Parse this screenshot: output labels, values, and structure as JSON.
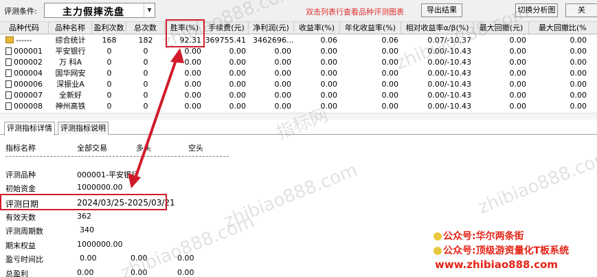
{
  "toolbar": {
    "cond_label": "评测条件:",
    "cond_value": "主力假摔洗盘",
    "hint": "双击列表行查看品种评测图表",
    "export_label": "导出结果",
    "switch_label": "切换分析图",
    "close_label": "关"
  },
  "columns": [
    "品种代码",
    "品种名称",
    "盈利次数",
    "总次数",
    "胜率(%)",
    "手续费(元)",
    "净利润(元)",
    "收益率(%)",
    "年化收益率(%)",
    "相对收益率α/β(%)",
    "最大回撤(元)",
    "最大回撤比(%"
  ],
  "rows": [
    {
      "code": "------",
      "name": "综合统计",
      "win": "168",
      "total": "182",
      "rate": "92.31",
      "fee": "369755.41",
      "profit": "3462696....",
      "ret": "0.06",
      "ann": "0.06",
      "rel": "0.07/-10.37",
      "dd": "0.00",
      "ddp": "0.00",
      "icon": "folder"
    },
    {
      "code": "000001",
      "name": "平安银行",
      "win": "0",
      "total": "0",
      "rate": "0.00",
      "fee": "0.00",
      "profit": "0.00",
      "ret": "0.00",
      "ann": "0.00",
      "rel": "0.00/-10.43",
      "dd": "0.00",
      "ddp": "0.00",
      "icon": "doc"
    },
    {
      "code": "000002",
      "name": "万 科A",
      "win": "0",
      "total": "0",
      "rate": "0.00",
      "fee": "0.00",
      "profit": "0.00",
      "ret": "0.00",
      "ann": "0.00",
      "rel": "0.00/-10.43",
      "dd": "0.00",
      "ddp": "0.00",
      "icon": "doc"
    },
    {
      "code": "000004",
      "name": "国华网安",
      "win": "0",
      "total": "0",
      "rate": "0.00",
      "fee": "0.00",
      "profit": "0.00",
      "ret": "0.00",
      "ann": "0.00",
      "rel": "0.00/-10.43",
      "dd": "0.00",
      "ddp": "0.00",
      "icon": "doc"
    },
    {
      "code": "000006",
      "name": "深振业A",
      "win": "0",
      "total": "0",
      "rate": "0.00",
      "fee": "0.00",
      "profit": "0.00",
      "ret": "0.00",
      "ann": "0.00",
      "rel": "0.00/-10.43",
      "dd": "0.00",
      "ddp": "0.00",
      "icon": "doc"
    },
    {
      "code": "000007",
      "name": "全新好",
      "win": "0",
      "total": "0",
      "rate": "0.00",
      "fee": "0.00",
      "profit": "0.00",
      "ret": "0.00",
      "ann": "0.00",
      "rel": "0.00/-10.43",
      "dd": "0.00",
      "ddp": "0.00",
      "icon": "doc"
    },
    {
      "code": "000008",
      "name": "神州高铁",
      "win": "0",
      "total": "0",
      "rate": "0.00",
      "fee": "0.00",
      "profit": "0.00",
      "ret": "0.00",
      "ann": "0.00",
      "rel": "0.00/-10.43",
      "dd": "0.00",
      "ddp": "0.00",
      "icon": "doc"
    }
  ],
  "tabs": [
    "评测指标详情",
    "评测指标说明"
  ],
  "detail": {
    "header": {
      "name": "指标名称",
      "all": "全部交易",
      "long": "多头",
      "short": "空头"
    },
    "stock": {
      "label": "评测品种",
      "value": "000001-平安银行"
    },
    "capital": {
      "label": "初始资金",
      "value": "1000000.00"
    },
    "date": {
      "label": "评测日期",
      "value": "2024/03/25-2025/03/21"
    },
    "valid_days": {
      "label": "有效天数",
      "value": "362"
    },
    "cycles": {
      "label": "评测周期数",
      "value": "340"
    },
    "equity": {
      "label": "期末权益",
      "value": "1000000.00"
    },
    "time_ratio": {
      "label": "盈亏时间比",
      "v1": "0.00",
      "v2": "0.00",
      "v3": "0.00"
    },
    "total_profit": {
      "label": "总盈利",
      "v1": "0.00",
      "v2": "0.00",
      "v3": "0.00"
    }
  },
  "watermark": {
    "main": "zhibiao888.com",
    "cn": "指标网"
  },
  "promo": {
    "line1": "公众号:华尔两条街",
    "line2": "公众号:顶级游资量化T板系统",
    "line3": "www.zhibiao888.com"
  },
  "colors": {
    "highlight": "#d11b2a",
    "promo": "#e52417",
    "hint": "#e03030"
  }
}
